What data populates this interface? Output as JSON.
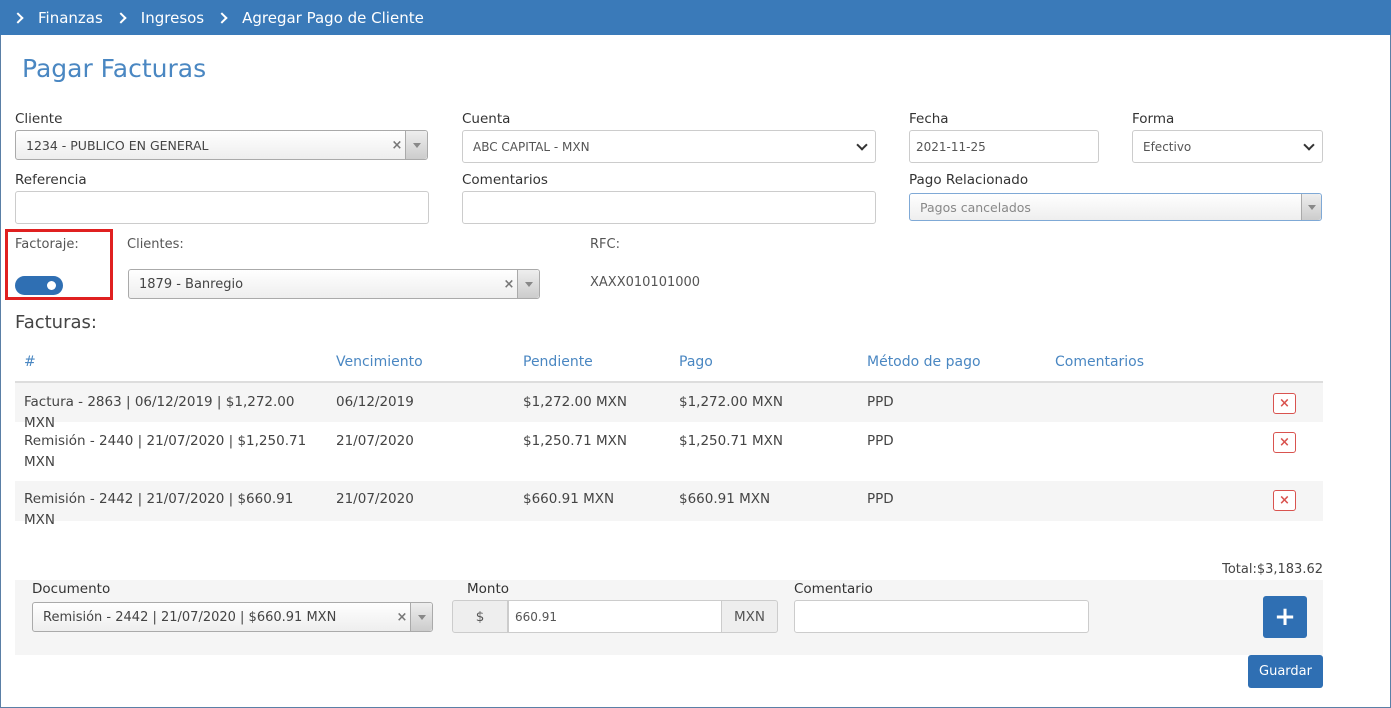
{
  "breadcrumb": [
    "Finanzas",
    "Ingresos",
    "Agregar Pago de Cliente"
  ],
  "page_title": "Pagar Facturas",
  "form": {
    "cliente": {
      "label": "Cliente",
      "value": "1234 - PUBLICO EN GENERAL"
    },
    "cuenta": {
      "label": "Cuenta",
      "value": "ABC CAPITAL - MXN"
    },
    "fecha": {
      "label": "Fecha",
      "value": "2021-11-25"
    },
    "forma": {
      "label": "Forma",
      "value": "Efectivo"
    },
    "referencia": {
      "label": "Referencia",
      "value": ""
    },
    "comentarios": {
      "label": "Comentarios",
      "value": ""
    },
    "pago_relacionado": {
      "label": "Pago Relacionado",
      "placeholder": "Pagos cancelados"
    }
  },
  "factoraje": {
    "label": "Factoraje:",
    "enabled": true
  },
  "clientes": {
    "label": "Clientes:",
    "value": "1879 - Banregio"
  },
  "rfc": {
    "label": "RFC:",
    "value": "XAXX010101000"
  },
  "facturas": {
    "title": "Facturas:",
    "columns": [
      "#",
      "Vencimiento",
      "Pendiente",
      "Pago",
      "Método de pago",
      "Comentarios"
    ],
    "rows": [
      {
        "doc": "Factura - 2863 | 06/12/2019 | $1,272.00 MXN",
        "vencimiento": "06/12/2019",
        "pendiente": "$1,272.00 MXN",
        "pago": "$1,272.00 MXN",
        "metodo": "PPD",
        "comentarios": ""
      },
      {
        "doc": "Remisión - 2440 | 21/07/2020 | $1,250.71 MXN",
        "vencimiento": "21/07/2020",
        "pendiente": "$1,250.71 MXN",
        "pago": "$1,250.71 MXN",
        "metodo": "PPD",
        "comentarios": ""
      },
      {
        "doc": "Remisión - 2442 | 21/07/2020 | $660.91 MXN",
        "vencimiento": "21/07/2020",
        "pendiente": "$660.91 MXN",
        "pago": "$660.91 MXN",
        "metodo": "PPD",
        "comentarios": ""
      }
    ],
    "delete_icon": "×"
  },
  "total": "Total:$3,183.62",
  "add_panel": {
    "documento": {
      "label": "Documento",
      "value": "Remisión - 2442 | 21/07/2020 | $660.91 MXN"
    },
    "monto": {
      "label": "Monto",
      "prefix": "$",
      "value": "660.91",
      "suffix": "MXN"
    },
    "comentario": {
      "label": "Comentario",
      "value": ""
    },
    "add_icon": "+"
  },
  "save_label": "Guardar",
  "colors": {
    "primary": "#2f6fb3",
    "header": "#3a7ab9",
    "title": "#4a87c2",
    "danger": "#d9534f",
    "highlight": "#e02020"
  }
}
